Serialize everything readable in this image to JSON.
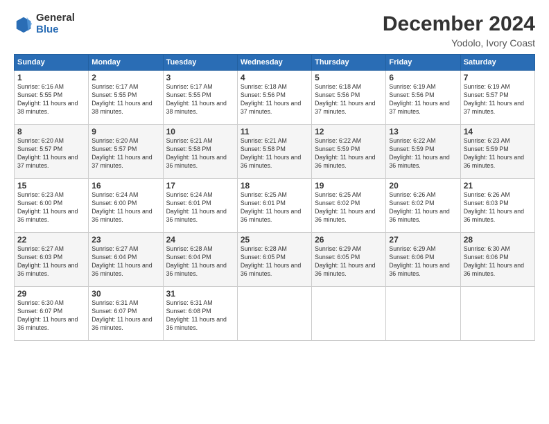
{
  "logo": {
    "general": "General",
    "blue": "Blue"
  },
  "title": {
    "month": "December 2024",
    "location": "Yodolo, Ivory Coast"
  },
  "headers": [
    "Sunday",
    "Monday",
    "Tuesday",
    "Wednesday",
    "Thursday",
    "Friday",
    "Saturday"
  ],
  "weeks": [
    [
      {
        "day": "1",
        "sunrise": "6:16 AM",
        "sunset": "5:55 PM",
        "daylight": "11 hours and 38 minutes."
      },
      {
        "day": "2",
        "sunrise": "6:17 AM",
        "sunset": "5:55 PM",
        "daylight": "11 hours and 38 minutes."
      },
      {
        "day": "3",
        "sunrise": "6:17 AM",
        "sunset": "5:55 PM",
        "daylight": "11 hours and 38 minutes."
      },
      {
        "day": "4",
        "sunrise": "6:18 AM",
        "sunset": "5:56 PM",
        "daylight": "11 hours and 37 minutes."
      },
      {
        "day": "5",
        "sunrise": "6:18 AM",
        "sunset": "5:56 PM",
        "daylight": "11 hours and 37 minutes."
      },
      {
        "day": "6",
        "sunrise": "6:19 AM",
        "sunset": "5:56 PM",
        "daylight": "11 hours and 37 minutes."
      },
      {
        "day": "7",
        "sunrise": "6:19 AM",
        "sunset": "5:57 PM",
        "daylight": "11 hours and 37 minutes."
      }
    ],
    [
      {
        "day": "8",
        "sunrise": "6:20 AM",
        "sunset": "5:57 PM",
        "daylight": "11 hours and 37 minutes."
      },
      {
        "day": "9",
        "sunrise": "6:20 AM",
        "sunset": "5:57 PM",
        "daylight": "11 hours and 37 minutes."
      },
      {
        "day": "10",
        "sunrise": "6:21 AM",
        "sunset": "5:58 PM",
        "daylight": "11 hours and 36 minutes."
      },
      {
        "day": "11",
        "sunrise": "6:21 AM",
        "sunset": "5:58 PM",
        "daylight": "11 hours and 36 minutes."
      },
      {
        "day": "12",
        "sunrise": "6:22 AM",
        "sunset": "5:59 PM",
        "daylight": "11 hours and 36 minutes."
      },
      {
        "day": "13",
        "sunrise": "6:22 AM",
        "sunset": "5:59 PM",
        "daylight": "11 hours and 36 minutes."
      },
      {
        "day": "14",
        "sunrise": "6:23 AM",
        "sunset": "5:59 PM",
        "daylight": "11 hours and 36 minutes."
      }
    ],
    [
      {
        "day": "15",
        "sunrise": "6:23 AM",
        "sunset": "6:00 PM",
        "daylight": "11 hours and 36 minutes."
      },
      {
        "day": "16",
        "sunrise": "6:24 AM",
        "sunset": "6:00 PM",
        "daylight": "11 hours and 36 minutes."
      },
      {
        "day": "17",
        "sunrise": "6:24 AM",
        "sunset": "6:01 PM",
        "daylight": "11 hours and 36 minutes."
      },
      {
        "day": "18",
        "sunrise": "6:25 AM",
        "sunset": "6:01 PM",
        "daylight": "11 hours and 36 minutes."
      },
      {
        "day": "19",
        "sunrise": "6:25 AM",
        "sunset": "6:02 PM",
        "daylight": "11 hours and 36 minutes."
      },
      {
        "day": "20",
        "sunrise": "6:26 AM",
        "sunset": "6:02 PM",
        "daylight": "11 hours and 36 minutes."
      },
      {
        "day": "21",
        "sunrise": "6:26 AM",
        "sunset": "6:03 PM",
        "daylight": "11 hours and 36 minutes."
      }
    ],
    [
      {
        "day": "22",
        "sunrise": "6:27 AM",
        "sunset": "6:03 PM",
        "daylight": "11 hours and 36 minutes."
      },
      {
        "day": "23",
        "sunrise": "6:27 AM",
        "sunset": "6:04 PM",
        "daylight": "11 hours and 36 minutes."
      },
      {
        "day": "24",
        "sunrise": "6:28 AM",
        "sunset": "6:04 PM",
        "daylight": "11 hours and 36 minutes."
      },
      {
        "day": "25",
        "sunrise": "6:28 AM",
        "sunset": "6:05 PM",
        "daylight": "11 hours and 36 minutes."
      },
      {
        "day": "26",
        "sunrise": "6:29 AM",
        "sunset": "6:05 PM",
        "daylight": "11 hours and 36 minutes."
      },
      {
        "day": "27",
        "sunrise": "6:29 AM",
        "sunset": "6:06 PM",
        "daylight": "11 hours and 36 minutes."
      },
      {
        "day": "28",
        "sunrise": "6:30 AM",
        "sunset": "6:06 PM",
        "daylight": "11 hours and 36 minutes."
      }
    ],
    [
      {
        "day": "29",
        "sunrise": "6:30 AM",
        "sunset": "6:07 PM",
        "daylight": "11 hours and 36 minutes."
      },
      {
        "day": "30",
        "sunrise": "6:31 AM",
        "sunset": "6:07 PM",
        "daylight": "11 hours and 36 minutes."
      },
      {
        "day": "31",
        "sunrise": "6:31 AM",
        "sunset": "6:08 PM",
        "daylight": "11 hours and 36 minutes."
      },
      null,
      null,
      null,
      null
    ]
  ],
  "labels": {
    "sunrise": "Sunrise:",
    "sunset": "Sunset:",
    "daylight": "Daylight:"
  }
}
